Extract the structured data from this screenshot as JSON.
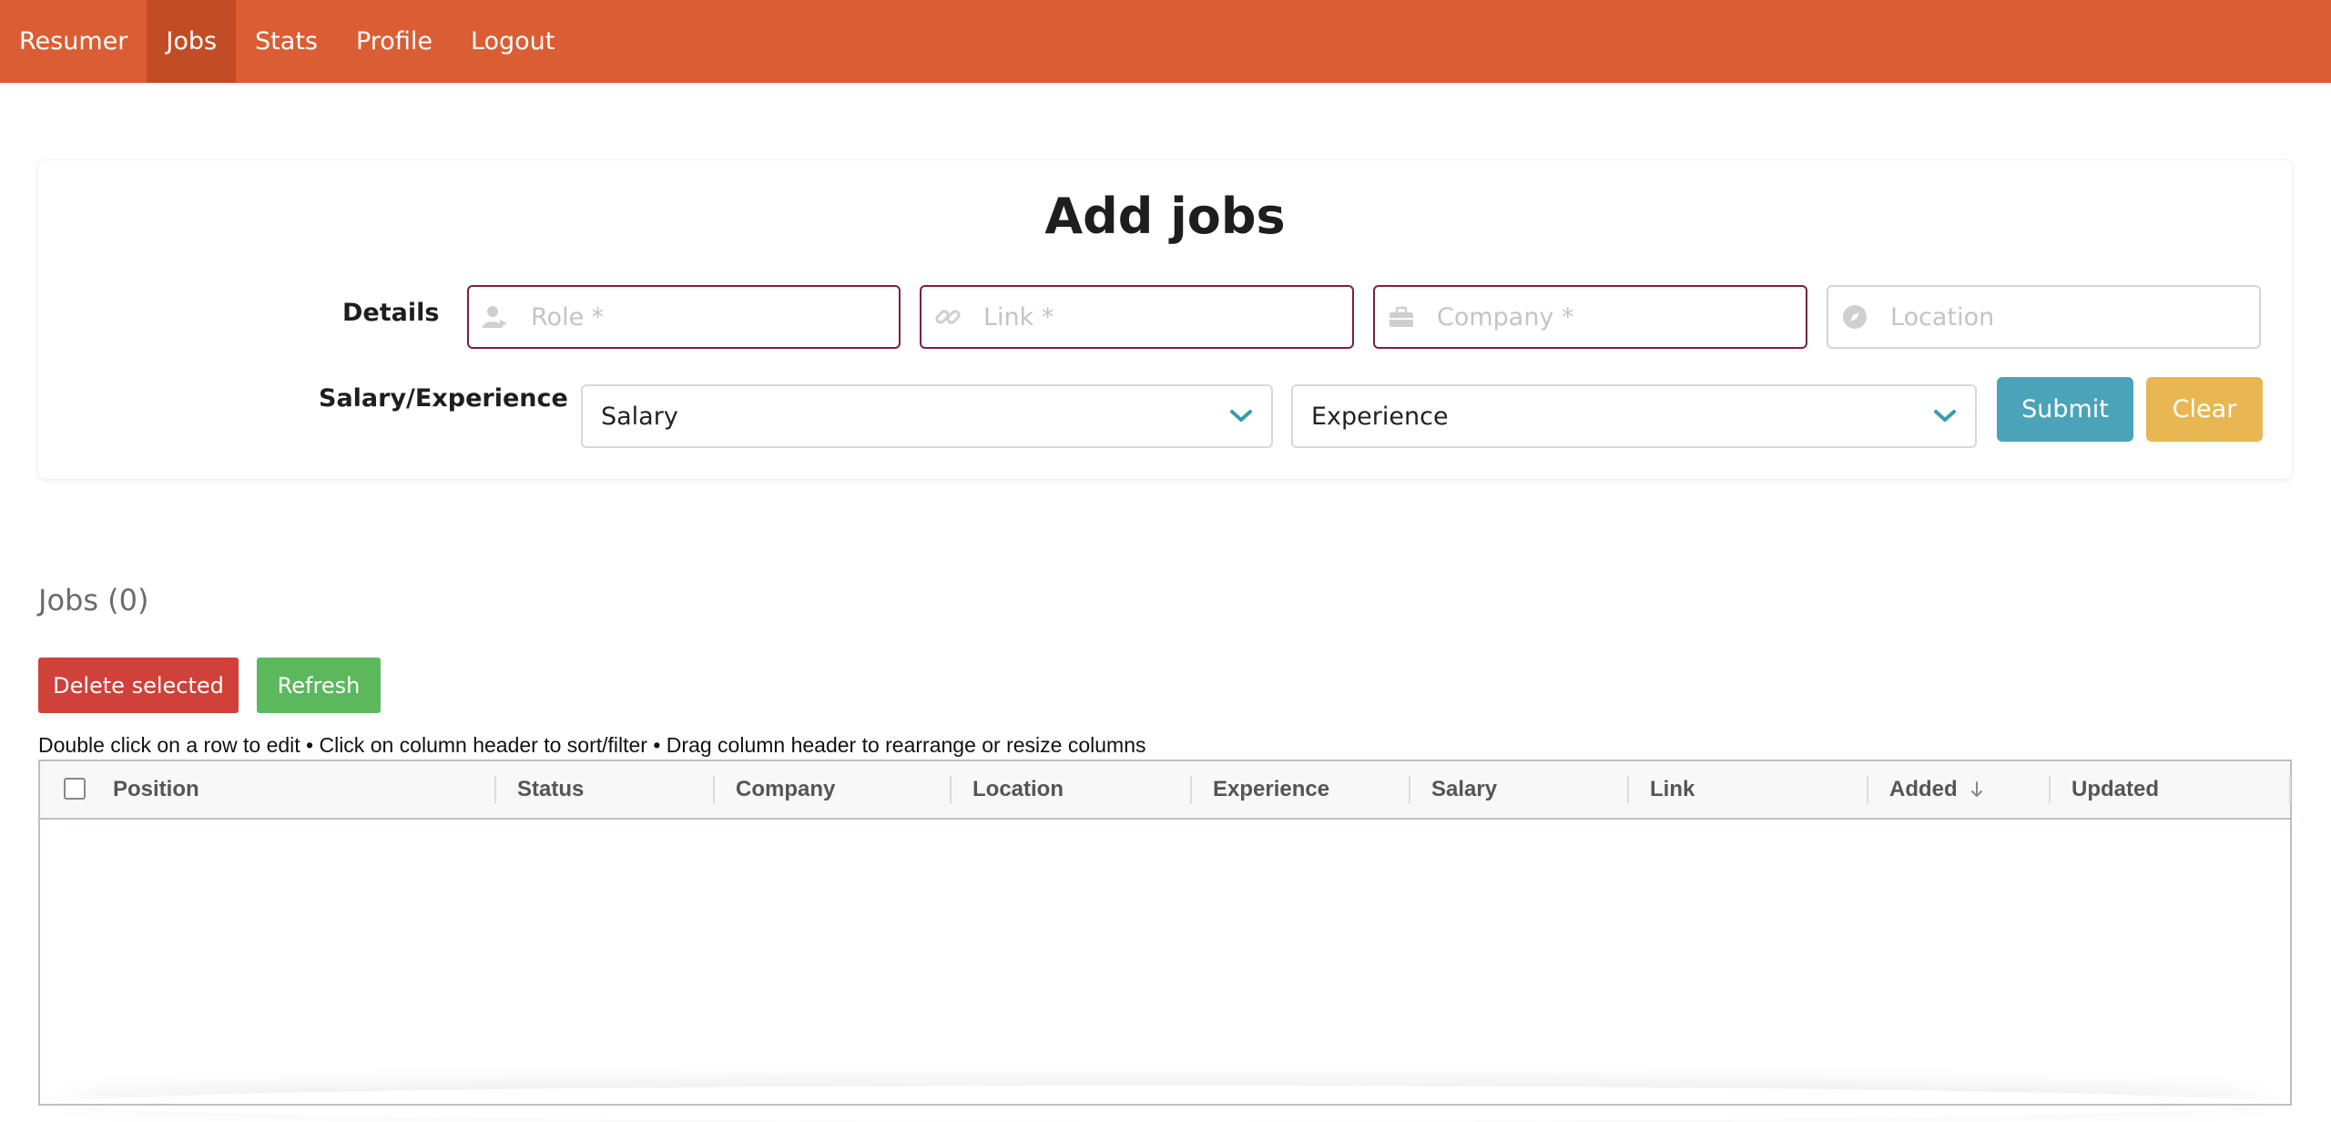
{
  "nav": {
    "items": [
      {
        "label": "Resumer"
      },
      {
        "label": "Jobs"
      },
      {
        "label": "Stats"
      },
      {
        "label": "Profile"
      },
      {
        "label": "Logout"
      }
    ],
    "active": "Jobs"
  },
  "form": {
    "title": "Add jobs",
    "details_label": "Details",
    "salary_label": "Salary/Experience",
    "role_placeholder": "Role *",
    "link_placeholder": "Link *",
    "company_placeholder": "Company *",
    "location_placeholder": "Location",
    "salary_select": "Salary",
    "experience_select": "Experience",
    "submit_label": "Submit",
    "clear_label": "Clear"
  },
  "jobs": {
    "heading": "Jobs (0)",
    "delete_label": "Delete selected",
    "refresh_label": "Refresh",
    "hint": "Double click on a row to edit • Click on column header to sort/filter • Drag column header to rearrange or resize columns",
    "columns": [
      "Position",
      "Status",
      "Company",
      "Location",
      "Experience",
      "Salary",
      "Link",
      "Added",
      "Updated"
    ],
    "sorted_column": "Added",
    "sort_direction": "descending",
    "rows": []
  },
  "colors": {
    "navbar": "#DB5D33",
    "navbar_active": "#C24D25",
    "required_border": "#7a1f4a",
    "submit": "#4AA3B8",
    "clear": "#E8B652",
    "delete": "#D0413A",
    "refresh": "#5CB85C",
    "chevron": "#3a9cb0"
  }
}
